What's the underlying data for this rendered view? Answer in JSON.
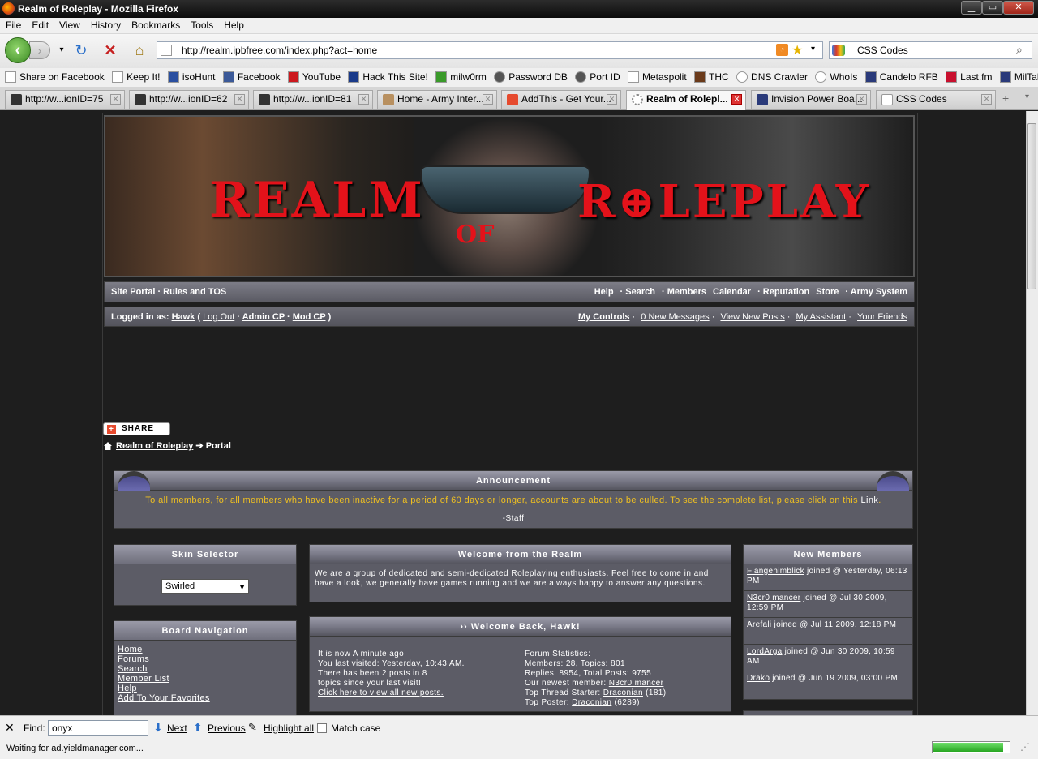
{
  "window": {
    "title": "Realm of Roleplay - Mozilla Firefox"
  },
  "menu": [
    "File",
    "Edit",
    "View",
    "History",
    "Bookmarks",
    "Tools",
    "Help"
  ],
  "nav": {
    "url": "http://realm.ipbfree.com/index.php?act=home",
    "search": "CSS Codes"
  },
  "bookmarks": [
    "Share on Facebook",
    "Keep It!",
    "isoHunt",
    "Facebook",
    "YouTube",
    "Hack This Site!",
    "milw0rm",
    "Password DB",
    "Port ID",
    "Metaspolit",
    "THC",
    "DNS Crawler",
    "WhoIs",
    "Candelo RFB",
    "Last.fm",
    "MilTalk"
  ],
  "tabs": [
    "http://w...ionID=75",
    "http://w...ionID=62",
    "http://w...ionID=81",
    "Home - Army Inter...",
    "AddThis - Get Your...",
    "Realm of Rolepl...",
    "Invision Power Boa...",
    "CSS Codes"
  ],
  "banner": {
    "left": "REALM",
    "of": "OF",
    "right": "R⊕LEPLAY"
  },
  "navrow": {
    "left": "Site Portal · Rules and TOS",
    "items": [
      "Help",
      "· Search",
      "· Members",
      "Calendar",
      "· Reputation",
      "Store",
      "· Army System"
    ]
  },
  "userrow": {
    "prefix": "Logged in as:",
    "user": "Hawk",
    "logout": "Log Out",
    "admin": "Admin CP",
    "mod": "Mod CP",
    "controls": "My Controls",
    "messages": "0 New Messages",
    "newposts": "View New Posts",
    "assistant": "My Assistant",
    "friends": "Your Friends"
  },
  "share": "SHARE",
  "crumb": {
    "home": "Realm of Roleplay",
    "current": "Portal"
  },
  "announce": {
    "title": "Announcement",
    "text": "To all members, for all members who have been inactive for a period of 60 days or longer, accounts are about to be culled. To see the complete list, please click on this",
    "link": "Link",
    "sig": "-Staff"
  },
  "skin": {
    "title": "Skin Selector",
    "value": "Swirled"
  },
  "boardnav": {
    "title": "Board Navigation",
    "links": [
      "Home",
      "Forums",
      "Search",
      "Member List",
      "Help",
      "Add To Your Favorites"
    ]
  },
  "welcome": {
    "title": "Welcome from the Realm",
    "text": "We are a group of dedicated and semi-dedicated Roleplaying enthusiasts. Feel free to come in and have a look, we generally have games running and we are always happy to answer any questions."
  },
  "welcomeback": {
    "title": "›› Welcome Back, Hawk!",
    "l1": "It is now A minute ago.",
    "l2": "You last visited: Yesterday, 10:43 AM.",
    "l3": "There has been 2 posts in 8",
    "l4": "topics since your last visit!",
    "l5": "Click here to view all new posts.",
    "r1": "Forum Statistics:",
    "r2": "Members: 28, Topics: 801",
    "r3": "Replies: 8954, Total Posts: 9755",
    "r4": "Our newest member:",
    "r4u": "N3cr0 mancer",
    "r5": "Top Thread Starter:",
    "r5u": "Draconian",
    "r5c": "(181)",
    "r6": "Top Poster:",
    "r6u": "Draconian",
    "r6c": "(6289)"
  },
  "newmembers": {
    "title": "New Members",
    "items": [
      {
        "name": "Flangenimblick",
        "when": "joined @ Yesterday, 06:13 PM"
      },
      {
        "name": "N3cr0 mancer",
        "when": "joined @ Jul 30 2009, 12:59 PM"
      },
      {
        "name": "Arefali",
        "when": "joined @ Jul 11 2009, 12:18 PM"
      },
      {
        "name": "LordArga",
        "when": "joined @ Jun 30 2009, 10:59 AM"
      },
      {
        "name": "Drako",
        "when": "joined @ Jun 19 2009, 03:00 PM"
      }
    ]
  },
  "find": {
    "label": "Find:",
    "value": "onyx",
    "next": "Next",
    "prev": "Previous",
    "highlight": "Highlight all",
    "match": "Match case"
  },
  "status": {
    "text": "Waiting for ad.yieldmanager.com...",
    "progress": 0.92
  }
}
